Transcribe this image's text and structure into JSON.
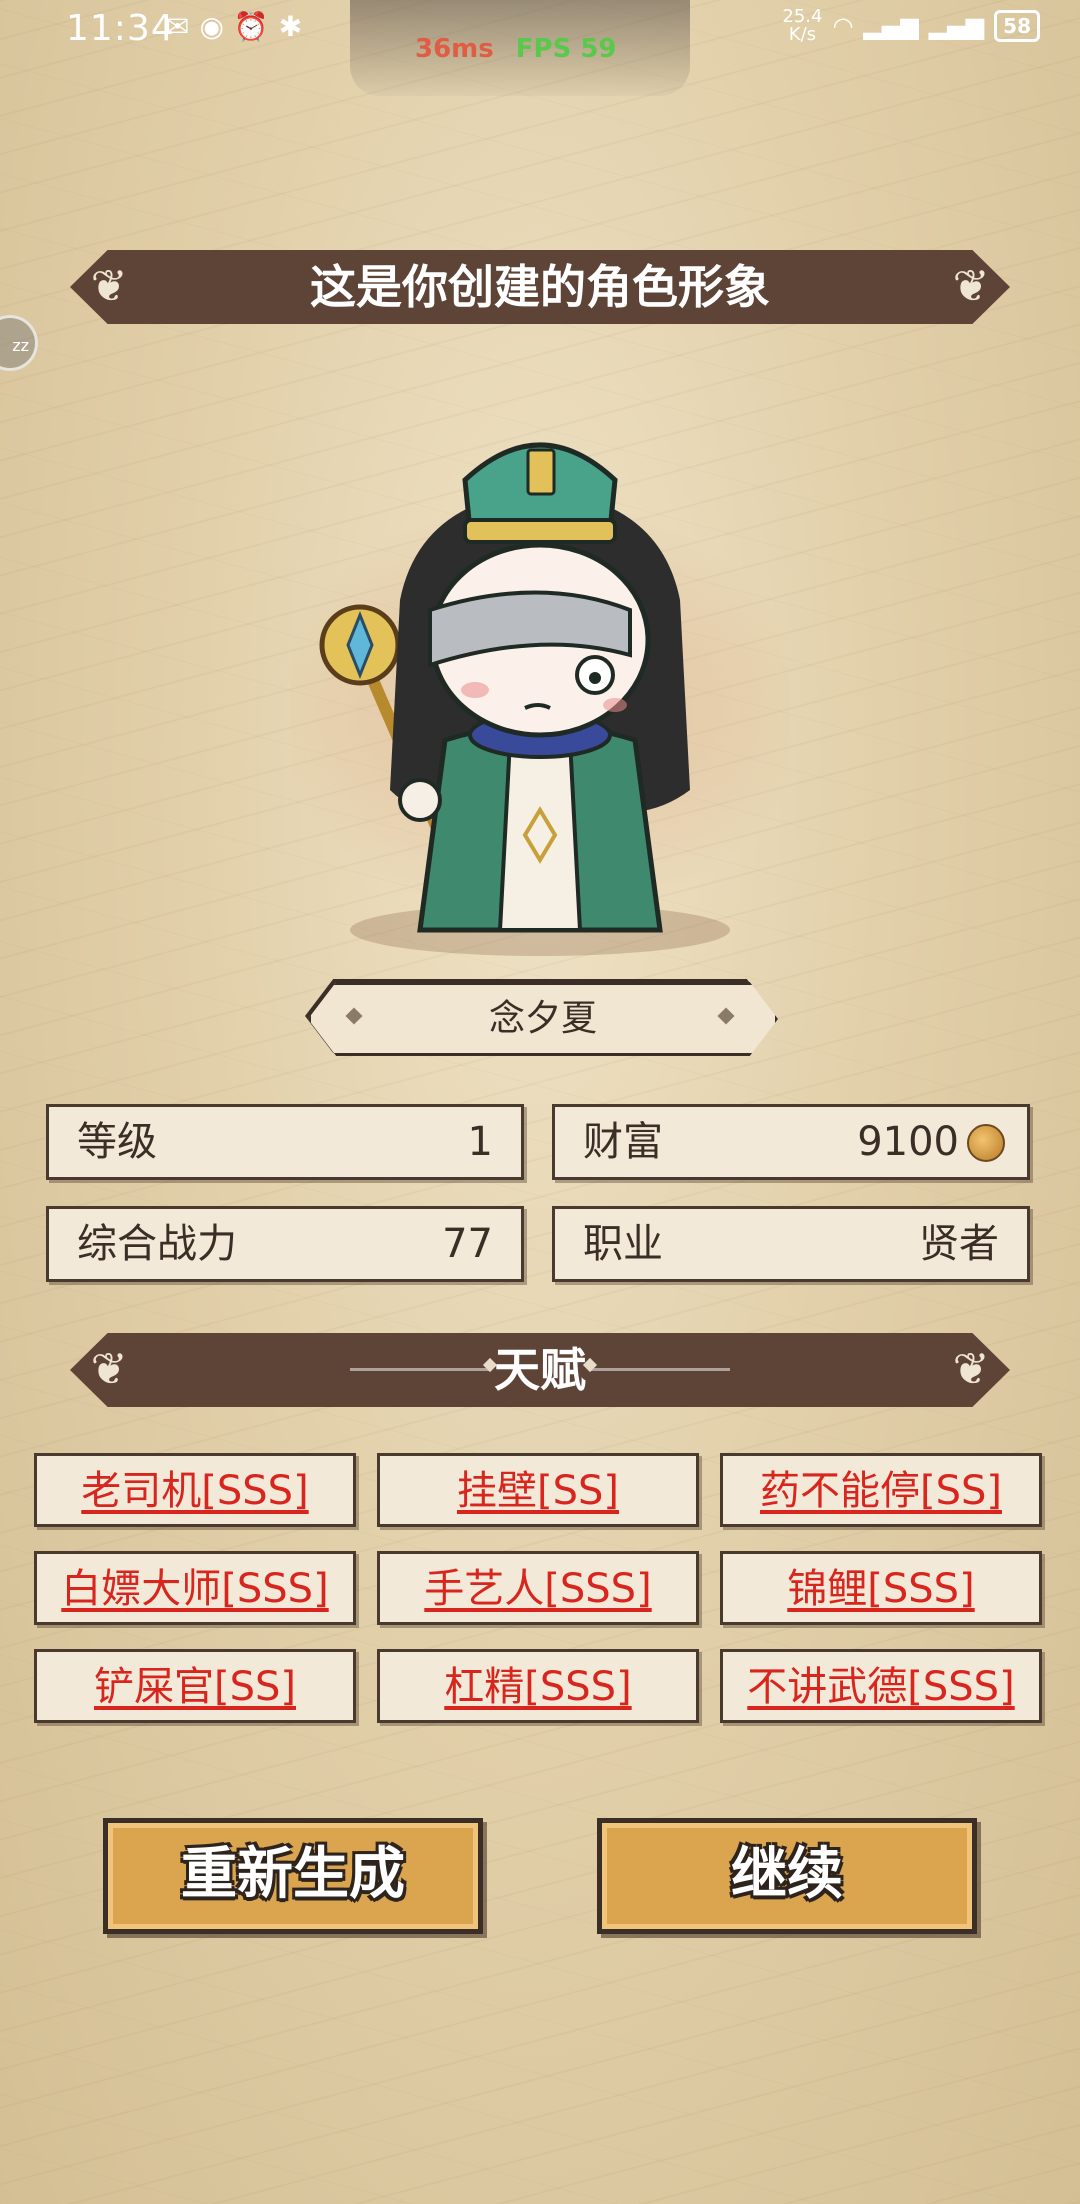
{
  "status_bar": {
    "time": "11:34",
    "net_speed": "25.4\nK/s",
    "net_speed_value": "25.4",
    "net_speed_unit": "K/s",
    "battery": "58",
    "ping": "36ms",
    "fps": "FPS 59"
  },
  "header": {
    "title": "这是你创建的角色形象"
  },
  "character": {
    "name": "念夕夏"
  },
  "stats": [
    {
      "label": "等级",
      "value": "1"
    },
    {
      "label": "财富",
      "value": "9100"
    },
    {
      "label": "综合战力",
      "value": "77"
    },
    {
      "label": "职业",
      "value": "贤者"
    }
  ],
  "talent_section": {
    "title": "天赋"
  },
  "talents": [
    "老司机[SSS]",
    "挂壁[SS]",
    "药不能停[SS]",
    "白嫖大师[SSS]",
    "手艺人[SSS]",
    "锦鲤[SSS]",
    "铲屎官[SS]",
    "杠精[SSS]",
    "不讲武德[SSS]"
  ],
  "buttons": {
    "regenerate": "重新生成",
    "continue": "继续"
  },
  "icons": {
    "coin": "coin-icon",
    "side_float": "zz"
  },
  "colors": {
    "banner": "#5e4337",
    "talent_text": "#d8261e",
    "button": "#dba54f",
    "card": "#f3e9d8"
  }
}
